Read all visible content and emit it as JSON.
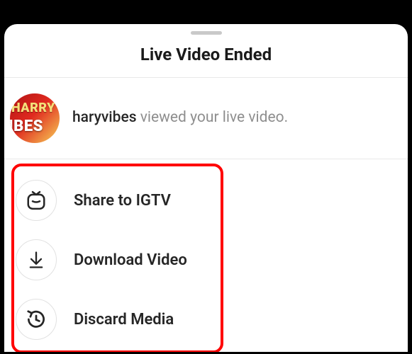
{
  "sheet": {
    "title": "Live Video Ended",
    "viewer": {
      "username": "haryvibes",
      "suffix": " viewed your live video.",
      "avatar_text1": "HARRY",
      "avatar_text2": "IBES"
    },
    "options": [
      {
        "label": "Share to IGTV"
      },
      {
        "label": "Download Video"
      },
      {
        "label": "Discard Media"
      }
    ]
  }
}
